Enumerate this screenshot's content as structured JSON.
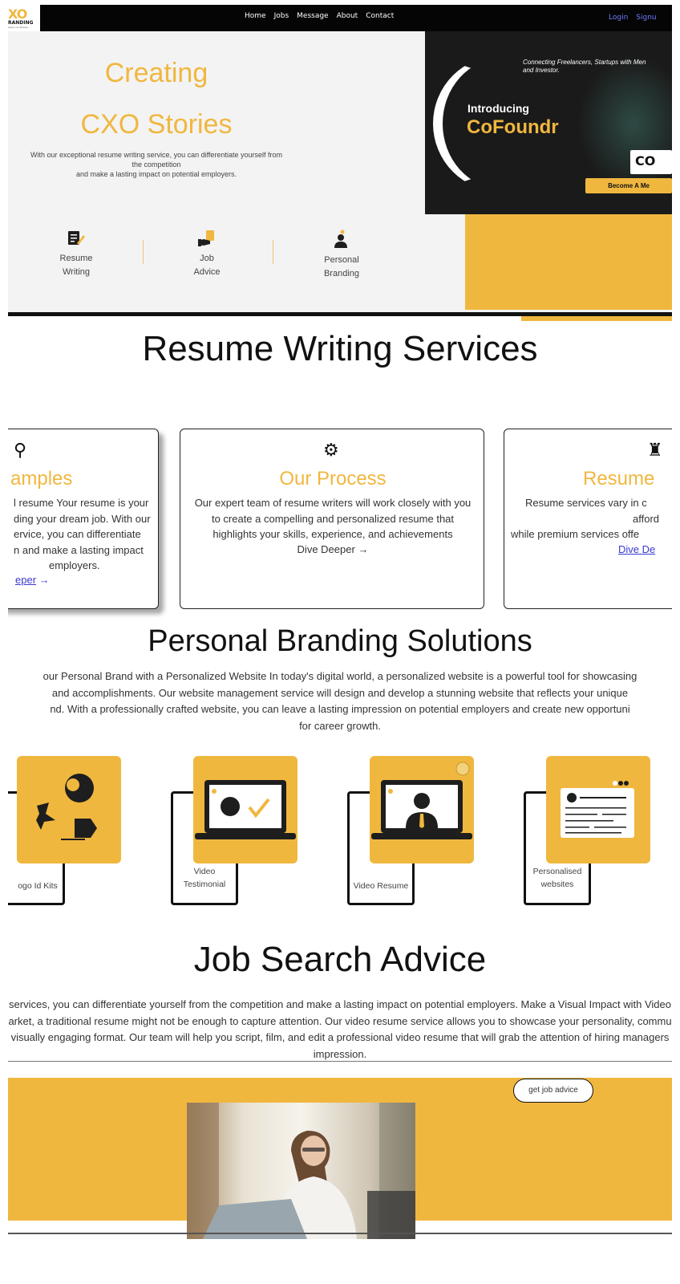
{
  "nav": {
    "logo_main": "XO",
    "logo_sub": "RANDING",
    "logo_tag": "early cxo stories",
    "links": [
      "Home",
      "Jobs",
      "Message",
      "About",
      "Contact"
    ],
    "login": "Login",
    "signup": "Signu"
  },
  "hero": {
    "title_line1": "Creating",
    "title_line2": "CXO Stories",
    "description_line1": "With our exceptional resume writing service, you can differentiate yourself from",
    "description_line2": "the competition",
    "description_line3": "and make a lasting impact on potential employers.",
    "features": [
      {
        "line1": "Resume",
        "line2": "Writing",
        "icon": "resume-pencil-icon"
      },
      {
        "line1": "Job",
        "line2": "Advice",
        "icon": "hand-document-icon"
      },
      {
        "line1": "Personal",
        "line2": "Branding",
        "icon": "person-brand-icon"
      }
    ],
    "banner": {
      "connecting_line1": "Connecting Freelancers, Startups with Men",
      "connecting_line2": "and Investor.",
      "introducing": "Introducing",
      "brand": "CoFoundr",
      "mini_logo": "CO",
      "cta": "Become A Me"
    }
  },
  "resume_section": {
    "title": "Resume Writing Services",
    "cards": [
      {
        "title": "amples",
        "lines": [
          "l resume Your resume is your",
          "ding your dream job. With our",
          "ervice, you can differentiate",
          "n and make a lasting impact",
          "employers."
        ],
        "link": "eper"
      },
      {
        "title": "Our Process",
        "lines": [
          "Our expert team of resume writers will work closely with you",
          "to create a compelling and personalized resume that",
          "highlights your skills, experience, and achievements"
        ],
        "link": "Dive Deeper"
      },
      {
        "title": "Resume",
        "lines": [
          "Resume services vary in c",
          "afford",
          "while premium services offe"
        ],
        "link": "Dive De"
      }
    ],
    "arrow": "→"
  },
  "branding_section": {
    "title": "Personal Branding Solutions",
    "lines": [
      "our Personal Brand with a Personalized Website In today's digital world, a personalized website is a powerful tool for showcasing",
      "and accomplishments. Our website management service will design and develop a stunning website that reflects your unique",
      "nd. With a professionally crafted website, you can leave a lasting impression on potential employers and create new opportuni",
      "for career growth."
    ],
    "tiles": [
      {
        "caption_line1": "ogo Id Kits",
        "caption_line2": ""
      },
      {
        "caption_line1": "Video",
        "caption_line2": "Testimonial"
      },
      {
        "caption_line1": "Video Resume",
        "caption_line2": ""
      },
      {
        "caption_line1": "Personalised",
        "caption_line2": "websites"
      }
    ]
  },
  "job_section": {
    "title": "Job Search Advice",
    "lines": [
      "services, you can differentiate yourself from the competition and make a lasting impact on potential employers. Make a Visual Impact with Video",
      "arket, a traditional resume might not be enough to capture attention. Our video resume service allows you to showcase your personality, commu",
      "visually engaging format. Our team will help you script, film, and edit a professional video resume that will grab the attention of hiring managers",
      "impression."
    ],
    "button": "get job advice"
  },
  "colors": {
    "accent": "#f0b73f",
    "nav_bg": "#050505",
    "link_blue": "#3a3ad0"
  }
}
